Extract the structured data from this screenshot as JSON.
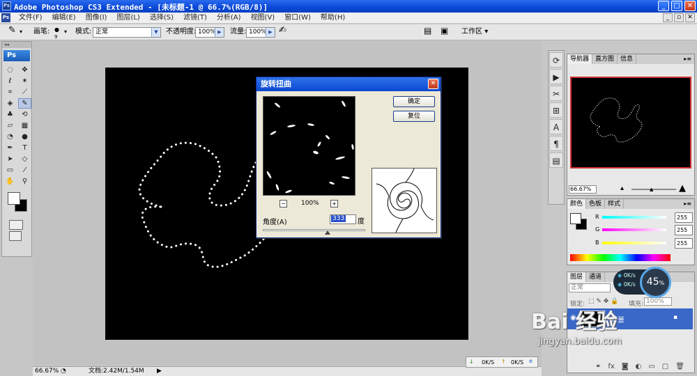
{
  "window": {
    "title": "Adobe Photoshop CS3 Extended - [未标题-1 @ 66.7%(RGB/8)]",
    "app_icon": "Ps"
  },
  "menubar": {
    "items": [
      "文件(F)",
      "编辑(E)",
      "图像(I)",
      "图层(L)",
      "选择(S)",
      "滤镜(T)",
      "分析(A)",
      "视图(V)",
      "窗口(W)",
      "帮助(H)"
    ]
  },
  "options": {
    "brush_label": "画笔:",
    "brush_size": "9",
    "mode_label": "模式:",
    "mode_value": "正常",
    "opacity_label": "不透明度:",
    "opacity_value": "100%",
    "flow_label": "流量:",
    "flow_value": "100%",
    "workspace_label": "工作区"
  },
  "toolbox": {
    "ps_logo": "Ps"
  },
  "dialog": {
    "title": "旋转扭曲",
    "ok_label": "确定",
    "reset_label": "复位",
    "zoom_value": "100%",
    "zoom_minus": "−",
    "zoom_plus": "+",
    "angle_label": "角度(A)",
    "angle_value": "333",
    "angle_unit": "度",
    "angle_slider_fraction": 0.63
  },
  "navigator": {
    "tabs": [
      "导航器",
      "直方图",
      "信息"
    ],
    "zoom_value": "66.67%"
  },
  "color_panel": {
    "tabs": [
      "颜色",
      "色板",
      "样式"
    ],
    "channels": [
      {
        "label": "R",
        "value": "255"
      },
      {
        "label": "G",
        "value": "255"
      },
      {
        "label": "B",
        "value": "255"
      }
    ]
  },
  "layers_panel": {
    "tabs": [
      "图层",
      "通道"
    ],
    "blend_mode": "正常",
    "lock_label": "锁定:",
    "fill_label": "填充:",
    "fill_value": "100%",
    "layer_name": "背景"
  },
  "statusbar": {
    "zoom_value": "66.67%",
    "doc_info": "文档:2.42M/1.54M"
  },
  "network_widget": {
    "up_speed": "0K/s",
    "down_speed": "0K/s",
    "percent": "45",
    "percent_unit": "%"
  },
  "speedbar": {
    "down": "0K/S",
    "up": "0K/S"
  },
  "watermark": {
    "brand": "Bai 经验",
    "url": "jingyan.baidu.com"
  }
}
